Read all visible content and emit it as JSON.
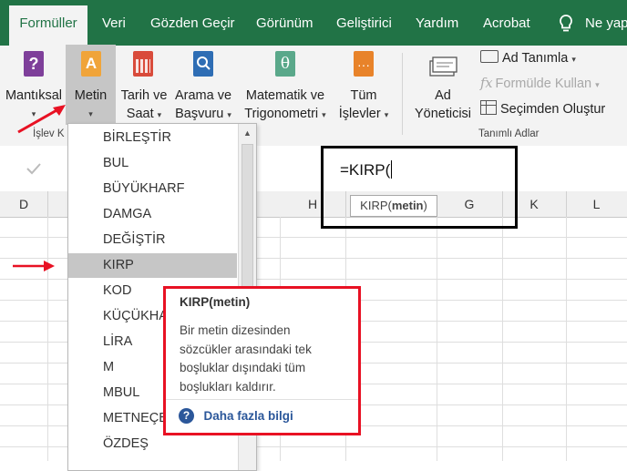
{
  "tabs": [
    "Formüller",
    "Veri",
    "Gözden Geçir",
    "Görünüm",
    "Geliştirici",
    "Yardım",
    "Acrobat",
    "Ne yap"
  ],
  "ribbon": {
    "mantiksal": "Mantıksal",
    "metin": "Metin",
    "tarih_1": "Tarih ve",
    "tarih_2": "Saat",
    "arama_1": "Arama ve",
    "arama_2": "Başvuru",
    "matematik_1": "Matematik ve",
    "matematik_2": "Trigonometri",
    "tum_1": "Tüm",
    "tum_2": "İşlevler",
    "ad_1": "Ad",
    "ad_2": "Yöneticisi",
    "ad_tanimla": "Ad Tanımla",
    "formulde_kullan": "Formülde Kullan",
    "secimden_olustur": "Seçimden Oluştur",
    "group_islev": "İşlev K",
    "group_tanimli": "Tanımlı Adlar"
  },
  "formula": {
    "text": "=KIRP(",
    "hint_func": "KIRP(",
    "hint_arg": "metin",
    "hint_close": ")"
  },
  "columns": [
    "D",
    "H",
    "G",
    "K",
    "L"
  ],
  "dropdown": [
    "BİRLEŞTİR",
    "BUL",
    "BÜYÜKHARF",
    "DAMGA",
    "DEĞİŞTİR",
    "KIRP",
    "KOD",
    "KÜÇÜKHA",
    "LİRA",
    "M",
    "MBUL",
    "METNEÇE",
    "ÖZDEŞ"
  ],
  "tooltip": {
    "title": "KIRP(metin)",
    "desc_1": "Bir metin dizesinden",
    "desc_2": "sözcükler arasındaki tek",
    "desc_3": "boşluklar dışındaki tüm",
    "desc_4": "boşlukları kaldırır.",
    "help": "Daha fazla bilgi"
  },
  "colors": {
    "excel_green": "#217346",
    "annotation_red": "#e81123",
    "selected_item": "#c6c6c6"
  }
}
